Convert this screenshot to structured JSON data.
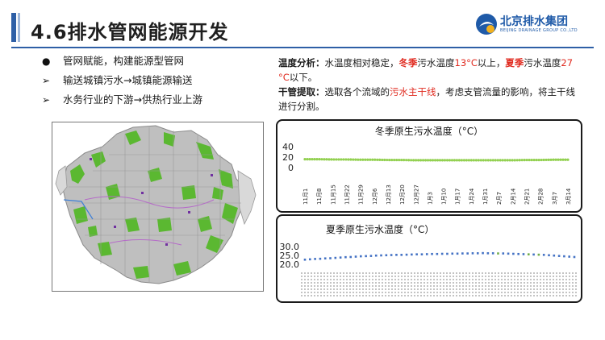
{
  "slide": {
    "title": "4.6排水管网能源开发"
  },
  "logo": {
    "name": "北京排水集团",
    "subtitle": "BEIJING DRAINAGE GROUP CO.,LTD",
    "brand_color": "#1f5aa8"
  },
  "bullets": [
    {
      "marker": "●",
      "text": "管网赋能，构建能源型管网"
    },
    {
      "marker": "➢",
      "text": "输送城镇污水→城镇能源输送"
    },
    {
      "marker": "➢",
      "text": "水务行业的下游→供热行业上游"
    }
  ],
  "analysis": {
    "temp_label": "温度分析：",
    "temp_text_1": "水温度相对稳定，",
    "temp_winter": "冬季",
    "temp_text_2": "污水温度",
    "temp_winter_value": "13°C",
    "temp_text_3": "以上，",
    "temp_summer": "夏季",
    "temp_text_4": "污水温度",
    "temp_summer_value": "27 °C",
    "temp_text_5": "以下。",
    "main_label": "干管提取：",
    "main_text_1": "选取各个流域的",
    "main_highlight": "污水主干线",
    "main_text_2": "，考虑支管流量的影响，将主干线进行分割。"
  },
  "chart_data": [
    {
      "type": "line",
      "title": "冬季原生污水温度（°C）",
      "yticks": [
        "40",
        "20",
        "0"
      ],
      "ylim": [
        0,
        40
      ],
      "x": [
        "11月1日",
        "11月8日",
        "11月15日",
        "11月22日",
        "11月29日",
        "12月6日",
        "12月13日",
        "12月20日",
        "12月27日",
        "1月3日",
        "1月10日",
        "1月17日",
        "1月24日",
        "1月31日",
        "2月7日",
        "2月14日",
        "2月21日",
        "2月28日",
        "3月7日",
        "3月14日"
      ],
      "xlabels": [
        "11月1",
        "11月8",
        "11月15",
        "11月22",
        "11月29",
        "12月6",
        "12月13",
        "12月20",
        "12月27",
        "1月3",
        "1月10",
        "1月17",
        "1月24",
        "1月31",
        "2月7",
        "2月14",
        "2月21",
        "2月28",
        "3月7",
        "3月14"
      ],
      "series": [
        {
          "values": [
            16,
            16,
            15.5,
            15.5,
            15,
            15,
            14.5,
            14.5,
            14,
            14,
            14,
            14,
            14,
            14,
            14,
            14,
            14.5,
            14.5,
            15,
            15
          ],
          "color": "#92d050"
        }
      ]
    },
    {
      "type": "line",
      "title": "夏季原生污水温度（°C）",
      "yticks": [
        "30.0",
        "25.0",
        "20.0"
      ],
      "ylim": [
        20,
        30
      ],
      "series": [
        {
          "values": [
            22.6,
            22.8,
            23.0,
            23.1,
            23.3,
            23.4,
            23.6,
            23.8,
            24.0,
            24.1,
            24.3,
            24.5,
            24.6,
            24.7,
            24.9,
            25.0,
            25.1,
            25.2,
            25.3,
            25.3,
            25.4,
            25.5,
            25.6,
            25.6,
            25.7,
            25.8,
            25.8,
            25.9,
            25.9,
            26.0,
            26.0,
            26.1,
            26.1,
            26.2,
            26.2,
            26.3,
            26.2,
            26.2,
            26.1,
            26.1,
            26.0,
            25.9,
            25.8,
            25.7,
            25.6,
            25.5,
            25.4,
            25.3,
            25.1,
            24.9,
            24.7,
            24.5,
            24.3,
            24.1
          ],
          "color": "#4472c4",
          "highlight_color": "#70ad47",
          "highlight_indices": [
            38,
            44,
            46
          ]
        }
      ]
    }
  ],
  "colors": {
    "accent": "#2e5fa6",
    "highlight_red": "#e02b20",
    "map_green": "#56b82a"
  }
}
